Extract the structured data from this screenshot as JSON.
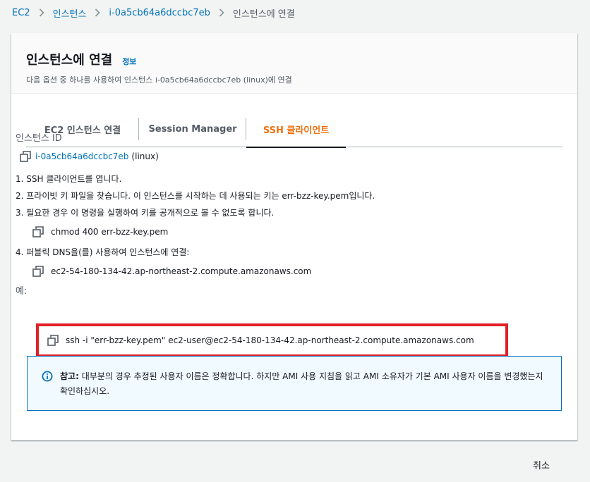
{
  "breadcrumb": {
    "items": [
      "EC2",
      "인스턴스",
      "i-0a5cb64a6dccbc7eb",
      "인스턴스에 연결"
    ]
  },
  "card": {
    "title": "인스턴스에 연결",
    "info_link": "정보",
    "description": "다음 옵션 중 하나를 사용하여 인스턴스 i-0a5cb64a6dccbc7eb (linux)에 연결"
  },
  "tabs": [
    {
      "label": "EC2 인스턴스 연결",
      "active": false
    },
    {
      "label": "Session Manager",
      "active": false
    },
    {
      "label": "SSH 클라이언트",
      "active": true
    }
  ],
  "instance": {
    "label": "인스턴스 ID",
    "id": "i-0a5cb64a6dccbc7eb",
    "os_suffix": "(linux)"
  },
  "steps": [
    "1. SSH 클라이언트를 엽니다.",
    "2. 프라이빗 키 파일을 찾습니다. 이 인스턴스를 시작하는 데 사용되는 키는 err-bzz-key.pem입니다.",
    "3. 필요한 경우 이 명령을 실행하여 키를 공개적으로 볼 수 없도록 합니다.",
    "4. 퍼블릭 DNS을(를) 사용하여 인스턴스에 연결:"
  ],
  "commands": {
    "chmod": "chmod 400 err-bzz-key.pem",
    "dns": "ec2-54-180-134-42.ap-northeast-2.compute.amazonaws.com",
    "example_label": "예:",
    "ssh": "ssh -i \"err-bzz-key.pem\" ec2-user@ec2-54-180-134-42.ap-northeast-2.compute.amazonaws.com"
  },
  "alert": {
    "bold": "참고:",
    "text": " 대부분의 경우 추정된 사용자 이름은 정확합니다. 하지만 AMI 사용 지침을 읽고 AMI 소유자가 기본 AMI 사용자 이름을 변경했는지 확인하십시오."
  },
  "footer": {
    "cancel": "취소"
  },
  "colors": {
    "link": "#0073bb",
    "active_tab": "#ec7211",
    "highlight_border": "#e12027",
    "alert_bg": "#f1faff"
  }
}
